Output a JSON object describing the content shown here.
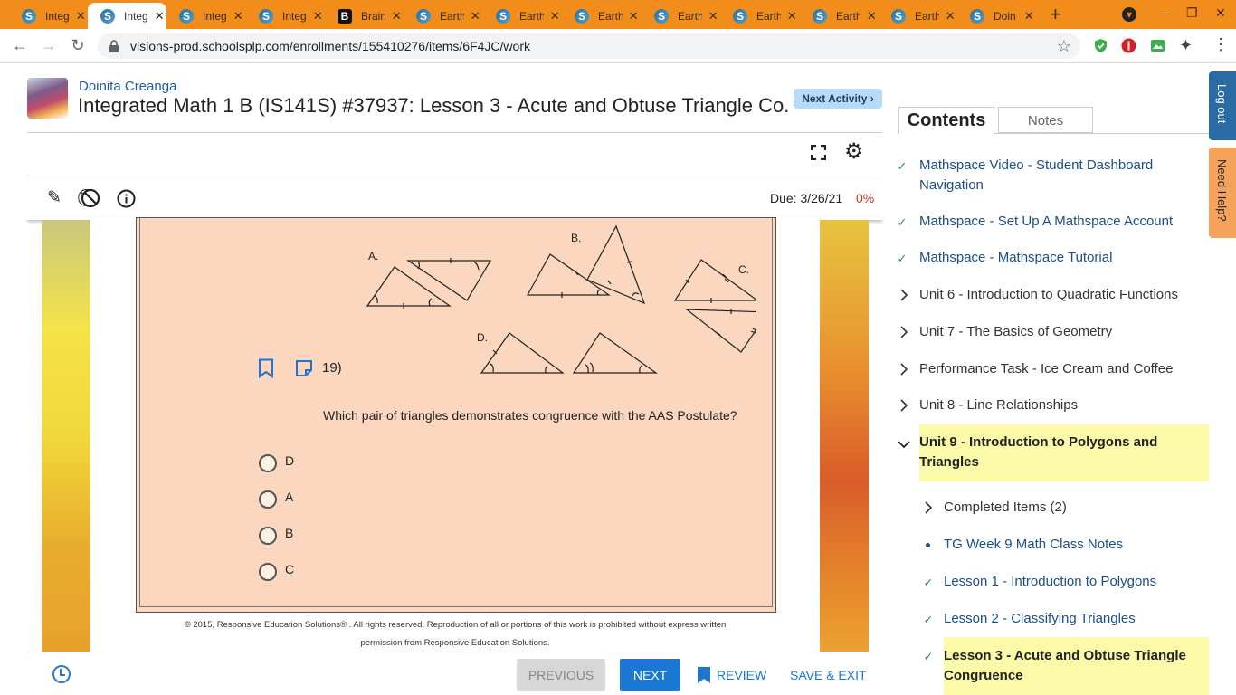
{
  "browser": {
    "tabs": [
      {
        "title": "Integ",
        "icon": "schoology-icon"
      },
      {
        "title": "Integ",
        "icon": "schoology-icon",
        "active": true
      },
      {
        "title": "Integ",
        "icon": "schoology-icon"
      },
      {
        "title": "Integ",
        "icon": "schoology-icon"
      },
      {
        "title": "Brain",
        "icon": "brainly-icon"
      },
      {
        "title": "Earth",
        "icon": "schoology-icon"
      },
      {
        "title": "Earth",
        "icon": "schoology-icon"
      },
      {
        "title": "Earth",
        "icon": "schoology-icon"
      },
      {
        "title": "Earth",
        "icon": "schoology-icon"
      },
      {
        "title": "Earth",
        "icon": "schoology-icon"
      },
      {
        "title": "Earth",
        "icon": "schoology-icon"
      },
      {
        "title": "Earth",
        "icon": "schoology-icon"
      },
      {
        "title": "Doin",
        "icon": "schoology-icon"
      }
    ],
    "url": "visions-prod.schoolsplp.com/enrollments/155410276/items/6F4JC/work",
    "accent_color": "#f28c1b"
  },
  "header": {
    "student_name": "Doinita Creanga",
    "assignment_title": "Integrated Math 1 B (IS141S) #37937: Lesson 3 - Acute and Obtuse Triangle Co...",
    "next_activity_label": "Next Activity ›"
  },
  "toolbar": {
    "due_date": "Due: 3/26/21",
    "progress": "0%"
  },
  "question": {
    "number": "19)",
    "figure_labels": [
      "A.",
      "B.",
      "C.",
      "D."
    ],
    "text": "Which pair of triangles demonstrates congruence with the AAS Postulate?",
    "choices": [
      "D",
      "A",
      "B",
      "C"
    ],
    "copyright_line1": "© 2015, Responsive Education Solutions® . All rights reserved. Reproduction of all or portions of this work is prohibited without express written",
    "copyright_line2": "permission from Responsive Education Solutions."
  },
  "footer": {
    "previous_label": "PREVIOUS",
    "next_label": "NEXT",
    "review_label": "REVIEW",
    "save_exit_label": "SAVE & EXIT"
  },
  "panel": {
    "tab_contents": "Contents",
    "tab_notes": "Notes",
    "items": [
      {
        "label": "Mathspace Video - Student Dashboard Navigation",
        "label_line1": "Mathspace Video - Student Dashboard",
        "label_line2": "Navigation",
        "state": "completed"
      },
      {
        "label": "Mathspace - Set Up A Mathspace Account",
        "state": "completed"
      },
      {
        "label": "Mathspace - Mathspace Tutorial",
        "state": "completed"
      },
      {
        "label": "Unit 6 - Introduction to Quadratic Functions",
        "state": "collapsed"
      },
      {
        "label": "Unit 7 - The Basics of Geometry",
        "state": "collapsed"
      },
      {
        "label": "Performance Task - Ice Cream and Coffee",
        "state": "collapsed"
      },
      {
        "label": "Unit 8 - Line Relationships",
        "state": "collapsed"
      },
      {
        "label": "Unit 9 - Introduction to Polygons and Triangles",
        "label_line1": "Unit 9 - Introduction to Polygons and",
        "label_line2": "Triangles",
        "state": "expanded"
      },
      {
        "label": "Completed Items (2)",
        "state": "collapsed"
      },
      {
        "label": "TG Week 9 Math Class Notes",
        "state": "in-progress"
      },
      {
        "label": "Lesson 1 - Introduction to Polygons",
        "state": "completed"
      },
      {
        "label": "Lesson 2 - Classifying Triangles",
        "state": "completed"
      },
      {
        "label": "Lesson 3 - Acute and Obtuse Triangle Congruence",
        "label_line1": "Lesson 3 - Acute and Obtuse Triangle",
        "label_line2": "Congruence",
        "state": "current"
      }
    ],
    "highlight_color": "#fafaa8"
  },
  "side_tabs": {
    "logout": "Log out",
    "help": "Need Help?"
  }
}
